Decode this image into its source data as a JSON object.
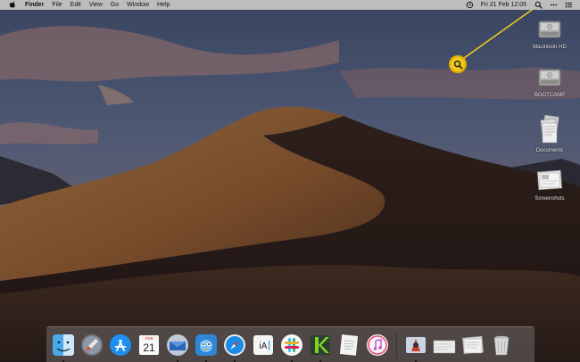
{
  "menubar": {
    "apple_icon": "apple-logo-icon",
    "app_name": "Finder",
    "menus": [
      "File",
      "Edit",
      "View",
      "Go",
      "Window",
      "Help"
    ],
    "datetime": "Fri 21 Feb  12:05",
    "status_icons": [
      "time-machine-icon",
      "spotlight-search-icon",
      "siri-icon",
      "notification-center-icon"
    ]
  },
  "desktop_items": [
    {
      "label": "Macintosh HD",
      "icon": "hard-drive-icon"
    },
    {
      "label": "BOOTCAMP",
      "icon": "hard-drive-icon"
    },
    {
      "label": "Documents",
      "icon": "document-stack-icon"
    },
    {
      "label": "Screenshots",
      "icon": "screenshot-file-icon"
    }
  ],
  "callout": {
    "icon": "magnifier-callout-icon",
    "color": "#f2c818"
  },
  "dock": {
    "apps": [
      {
        "icon": "finder-icon",
        "running": true
      },
      {
        "icon": "launchpad-icon",
        "running": false
      },
      {
        "icon": "app-store-icon",
        "running": false
      },
      {
        "icon": "calendar-icon",
        "running": false,
        "month": "FEB",
        "day": "21"
      },
      {
        "icon": "mail-icon",
        "running": true
      },
      {
        "icon": "tweetbot-icon",
        "running": true
      },
      {
        "icon": "safari-icon",
        "running": true
      },
      {
        "icon": "ia-writer-icon",
        "running": false,
        "text": "iA"
      },
      {
        "icon": "slack-icon",
        "running": true
      },
      {
        "icon": "kite-icon",
        "running": true
      },
      {
        "icon": "notes-icon",
        "running": false
      },
      {
        "icon": "itunes-icon",
        "running": false
      }
    ],
    "other": [
      {
        "icon": "utility-app-icon"
      },
      {
        "icon": "recent-document-icon"
      },
      {
        "icon": "downloads-stack-icon"
      },
      {
        "icon": "trash-icon"
      }
    ]
  }
}
